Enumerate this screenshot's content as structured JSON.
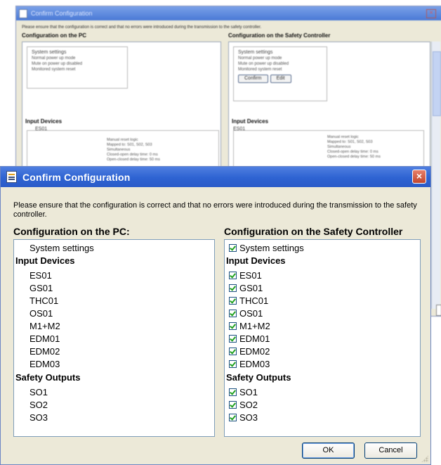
{
  "background_window": {
    "title": "Confirm Configuration",
    "instructions": "Please ensure that the configuration is correct and that no errors were introduced during the transmission to the safety controller.",
    "pc_heading": "Configuration on the PC",
    "sc_heading": "Configuration on the Safety Controller",
    "system_settings_title": "System settings",
    "system_settings_lines": [
      "Normal power up mode",
      "Mute on power up disabled",
      "Monitored system reset"
    ],
    "confirm_label": "Confirm",
    "edit_label": "Edit",
    "input_devices_label": "Input Devices",
    "es01_label": "ES01",
    "pc_details": [
      "Manual reset logic",
      "Mapped to: S01, S02, S03",
      "Simultaneous",
      "Closed-open delay time: 0 ms",
      "Open-closed delay time: 50 ms"
    ],
    "sc_details": [
      "Manual reset logic",
      "Mapped to: S01, S02, S03",
      "Simultaneous",
      "Closed-open delay time: 0 ms",
      "Open-closed delay time: 50 ms"
    ]
  },
  "dialog": {
    "title": "Confirm Configuration",
    "close_symbol": "×",
    "instructions": "Please ensure that the configuration is correct and that no errors were introduced during the transmission to the safety controller.",
    "pc_heading": "Configuration on the PC:",
    "sc_heading": "Configuration on the Safety Controller",
    "system_settings_label": "System settings",
    "input_devices_heading": "Input Devices",
    "input_devices": [
      "ES01",
      "GS01",
      "THC01",
      "OS01",
      "M1+M2",
      "EDM01",
      "EDM02",
      "EDM03"
    ],
    "safety_outputs_heading": "Safety Outputs",
    "safety_outputs": [
      "SO1",
      "SO2",
      "SO3"
    ],
    "ok_label": "OK",
    "cancel_label": "Cancel"
  },
  "colors": {
    "titlebar": "#2e63d2",
    "dialog_bg": "#ece9d8",
    "checkmark": "#21a121",
    "close_button": "#c2462e"
  },
  "icons": [
    "config-document-icon",
    "close-icon",
    "checkbox-checked-icon",
    "resize-grip-icon"
  ]
}
